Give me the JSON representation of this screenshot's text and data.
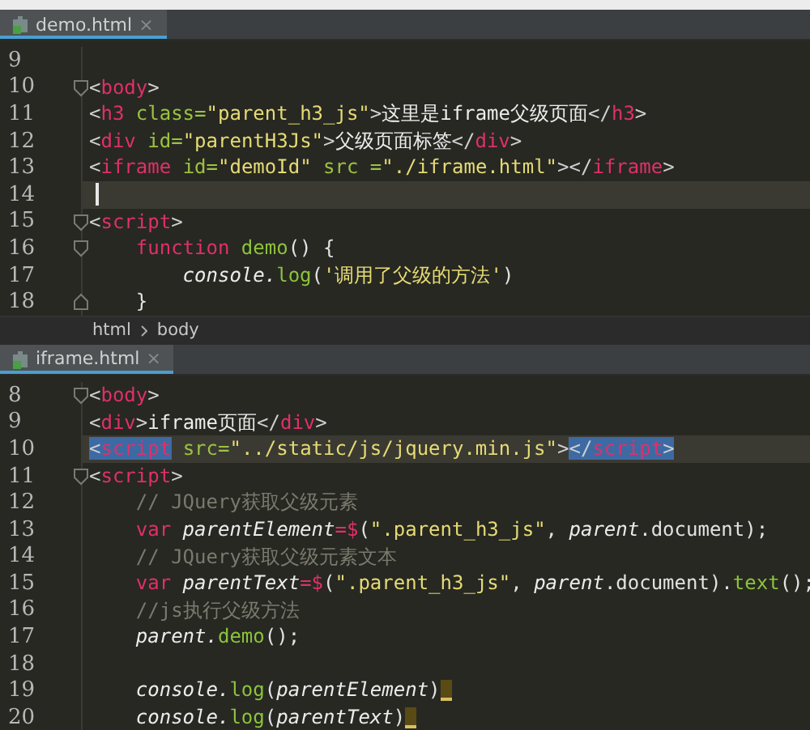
{
  "panes": [
    {
      "tab": {
        "label": "demo.html",
        "close": "×",
        "selected": true
      },
      "lines": [
        {
          "number": "9",
          "fold_start": false,
          "fold_end": false,
          "current": false,
          "caret": false,
          "trailing_mark": false
        },
        {
          "number": "10",
          "fold_start": true,
          "fold_end": false,
          "current": false,
          "caret": false,
          "trailing_mark": false,
          "tokens": [
            {
              "kind": "punct",
              "text": "<"
            },
            {
              "kind": "tag",
              "text": "body"
            },
            {
              "kind": "punct",
              "text": ">"
            }
          ]
        },
        {
          "number": "11",
          "fold_start": false,
          "fold_end": false,
          "current": false,
          "caret": false,
          "trailing_mark": false,
          "tokens": [
            {
              "kind": "punct",
              "text": "<"
            },
            {
              "kind": "tag",
              "text": "h3"
            },
            {
              "kind": "attr",
              "text": " class="
            },
            {
              "kind": "string",
              "text": "\"parent_h3_js\""
            },
            {
              "kind": "punct",
              "text": ">"
            },
            {
              "kind": "text",
              "text": "这里是iframe父级页面"
            },
            {
              "kind": "punct",
              "text": "</"
            },
            {
              "kind": "tag",
              "text": "h3"
            },
            {
              "kind": "punct",
              "text": ">"
            }
          ]
        },
        {
          "number": "12",
          "fold_start": false,
          "fold_end": false,
          "current": false,
          "caret": false,
          "trailing_mark": false,
          "tokens": [
            {
              "kind": "punct",
              "text": "<"
            },
            {
              "kind": "tag",
              "text": "div"
            },
            {
              "kind": "attr",
              "text": " id="
            },
            {
              "kind": "string",
              "text": "\"parentH3Js\""
            },
            {
              "kind": "punct",
              "text": ">"
            },
            {
              "kind": "text",
              "text": "父级页面标签"
            },
            {
              "kind": "punct",
              "text": "</"
            },
            {
              "kind": "tag",
              "text": "div"
            },
            {
              "kind": "punct",
              "text": ">"
            }
          ]
        },
        {
          "number": "13",
          "fold_start": false,
          "fold_end": false,
          "current": false,
          "caret": false,
          "trailing_mark": false,
          "tokens": [
            {
              "kind": "punct",
              "text": "<"
            },
            {
              "kind": "tag",
              "text": "iframe"
            },
            {
              "kind": "attr",
              "text": " id="
            },
            {
              "kind": "string",
              "text": "\"demoId\""
            },
            {
              "kind": "attr",
              "text": " src ="
            },
            {
              "kind": "string",
              "text": "\"./iframe.html\""
            },
            {
              "kind": "punct",
              "text": ">"
            },
            {
              "kind": "punct",
              "text": "</"
            },
            {
              "kind": "tag",
              "text": "iframe"
            },
            {
              "kind": "punct",
              "text": ">"
            }
          ]
        },
        {
          "number": "14",
          "fold_start": false,
          "fold_end": false,
          "current": true,
          "caret": true,
          "trailing_mark": false
        },
        {
          "number": "15",
          "fold_start": true,
          "fold_end": false,
          "current": false,
          "caret": false,
          "trailing_mark": false,
          "tokens": [
            {
              "kind": "punct",
              "text": "<"
            },
            {
              "kind": "tag",
              "text": "script"
            },
            {
              "kind": "punct",
              "text": ">"
            }
          ]
        },
        {
          "number": "16",
          "fold_start": true,
          "fold_end": false,
          "current": false,
          "caret": false,
          "trailing_mark": false,
          "tokens": [
            {
              "kind": "keyword",
              "text": "    function"
            },
            {
              "kind": "func",
              "text": " demo"
            },
            {
              "kind": "plain",
              "text": "() {"
            }
          ]
        },
        {
          "number": "17",
          "fold_start": false,
          "fold_end": false,
          "current": false,
          "caret": false,
          "trailing_mark": false,
          "tokens": [
            {
              "kind": "italic",
              "text": "        console."
            },
            {
              "kind": "func",
              "text": "log"
            },
            {
              "kind": "plain",
              "text": "("
            },
            {
              "kind": "string",
              "text": "'调用了父级的方法'"
            },
            {
              "kind": "plain",
              "text": ")"
            }
          ]
        },
        {
          "number": "18",
          "fold_start": false,
          "fold_end": true,
          "current": false,
          "caret": false,
          "trailing_mark": false,
          "tokens": [
            {
              "kind": "plain",
              "text": "    }"
            }
          ]
        }
      ],
      "breadcrumb": [
        "html",
        "body"
      ]
    },
    {
      "tab": {
        "label": "iframe.html",
        "close": "×",
        "selected": true
      },
      "lines": [
        {
          "number": "8",
          "fold_start": true,
          "fold_end": false,
          "current": false,
          "caret": false,
          "trailing_mark": false,
          "tokens": [
            {
              "kind": "punct",
              "text": "<"
            },
            {
              "kind": "tag",
              "text": "body"
            },
            {
              "kind": "punct",
              "text": ">"
            }
          ]
        },
        {
          "number": "9",
          "fold_start": false,
          "fold_end": false,
          "current": false,
          "caret": false,
          "trailing_mark": false,
          "tokens": [
            {
              "kind": "punct",
              "text": "<"
            },
            {
              "kind": "tag",
              "text": "div"
            },
            {
              "kind": "punct",
              "text": ">"
            },
            {
              "kind": "text",
              "text": "iframe页面"
            },
            {
              "kind": "punct",
              "text": "</"
            },
            {
              "kind": "tag",
              "text": "div"
            },
            {
              "kind": "punct",
              "text": ">"
            }
          ]
        },
        {
          "number": "10",
          "fold_start": false,
          "fold_end": false,
          "current": true,
          "caret": false,
          "trailing_mark": false,
          "tokens": [
            {
              "kind": "punct",
              "text": "<",
              "selected": true
            },
            {
              "kind": "tag",
              "text": "script",
              "selected": true
            },
            {
              "kind": "attr",
              "text": " src=",
              "selected": false
            },
            {
              "kind": "string",
              "text": "\"../static/js/jquery.min.js\"",
              "selected": false
            },
            {
              "kind": "punct",
              "text": ">",
              "selected": false
            },
            {
              "kind": "punct",
              "text": "</",
              "selected": true
            },
            {
              "kind": "tag",
              "text": "script",
              "selected": true
            },
            {
              "kind": "punct",
              "text": ">",
              "selected": true
            }
          ]
        },
        {
          "number": "11",
          "fold_start": true,
          "fold_end": false,
          "current": false,
          "caret": false,
          "trailing_mark": false,
          "tokens": [
            {
              "kind": "punct",
              "text": "<"
            },
            {
              "kind": "tag",
              "text": "script"
            },
            {
              "kind": "punct",
              "text": ">"
            }
          ]
        },
        {
          "number": "12",
          "fold_start": false,
          "fold_end": false,
          "current": false,
          "caret": false,
          "trailing_mark": false,
          "tokens": [
            {
              "kind": "comment",
              "text": "    // JQuery获取父级元素"
            }
          ]
        },
        {
          "number": "13",
          "fold_start": false,
          "fold_end": false,
          "current": false,
          "caret": false,
          "trailing_mark": false,
          "tokens": [
            {
              "kind": "keyword",
              "text": "    var"
            },
            {
              "kind": "italic",
              "text": " parentElement"
            },
            {
              "kind": "keyword",
              "text": "=$"
            },
            {
              "kind": "plain",
              "text": "("
            },
            {
              "kind": "string",
              "text": "\".parent_h3_js\""
            },
            {
              "kind": "plain",
              "text": ", "
            },
            {
              "kind": "italic",
              "text": "parent"
            },
            {
              "kind": "plain",
              "text": ".document);"
            }
          ]
        },
        {
          "number": "14",
          "fold_start": false,
          "fold_end": false,
          "current": false,
          "caret": false,
          "trailing_mark": false,
          "tokens": [
            {
              "kind": "comment",
              "text": "    // JQuery获取父级元素文本"
            }
          ]
        },
        {
          "number": "15",
          "fold_start": false,
          "fold_end": false,
          "current": false,
          "caret": false,
          "trailing_mark": false,
          "tokens": [
            {
              "kind": "keyword",
              "text": "    var"
            },
            {
              "kind": "italic",
              "text": " parentText"
            },
            {
              "kind": "keyword",
              "text": "=$"
            },
            {
              "kind": "plain",
              "text": "("
            },
            {
              "kind": "string",
              "text": "\".parent_h3_js\""
            },
            {
              "kind": "plain",
              "text": ", "
            },
            {
              "kind": "italic",
              "text": "parent"
            },
            {
              "kind": "plain",
              "text": ".document)."
            },
            {
              "kind": "func",
              "text": "text"
            },
            {
              "kind": "plain",
              "text": "();"
            }
          ]
        },
        {
          "number": "16",
          "fold_start": false,
          "fold_end": false,
          "current": false,
          "caret": false,
          "trailing_mark": false,
          "tokens": [
            {
              "kind": "comment",
              "text": "    //js执行父级方法"
            }
          ]
        },
        {
          "number": "17",
          "fold_start": false,
          "fold_end": false,
          "current": false,
          "caret": false,
          "trailing_mark": false,
          "tokens": [
            {
              "kind": "italic",
              "text": "    parent."
            },
            {
              "kind": "func",
              "text": "demo"
            },
            {
              "kind": "plain",
              "text": "();"
            }
          ]
        },
        {
          "number": "18",
          "fold_start": false,
          "fold_end": false,
          "current": false,
          "caret": false,
          "trailing_mark": false
        },
        {
          "number": "19",
          "fold_start": false,
          "fold_end": false,
          "current": false,
          "caret": false,
          "trailing_mark": true,
          "tokens": [
            {
              "kind": "italic",
              "text": "    console."
            },
            {
              "kind": "func",
              "text": "log"
            },
            {
              "kind": "plain",
              "text": "("
            },
            {
              "kind": "italic",
              "text": "parentElement"
            },
            {
              "kind": "plain",
              "text": ")"
            }
          ]
        },
        {
          "number": "20",
          "fold_start": false,
          "fold_end": false,
          "current": false,
          "caret": false,
          "trailing_mark": true,
          "tokens": [
            {
              "kind": "italic",
              "text": "    console."
            },
            {
              "kind": "func",
              "text": "log"
            },
            {
              "kind": "plain",
              "text": "("
            },
            {
              "kind": "italic",
              "text": "parentText"
            },
            {
              "kind": "plain",
              "text": ")"
            }
          ]
        }
      ]
    }
  ]
}
